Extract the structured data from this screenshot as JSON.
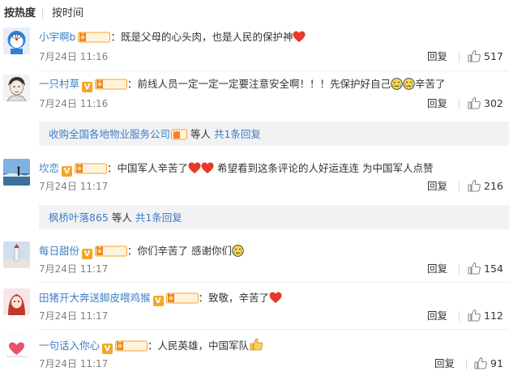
{
  "sort": {
    "hot": "按热度",
    "time": "按时间"
  },
  "labels": {
    "reply": "回复",
    "fan": "铁粉"
  },
  "colors": {
    "link": "#3b7fc4",
    "heart": "#e8382a",
    "badge": "#f5a623"
  },
  "comments": [
    {
      "user": "小宇啊b",
      "text": "：既是父母的心头肉，也是人民的保护神",
      "time": "7月24日 11:16",
      "likes": "517"
    },
    {
      "user": "一只村草",
      "text": "：前线人员一定一定一定要注意安全啊！！！先保护好自己",
      "text2": "辛苦了",
      "time": "7月24日 11:16",
      "likes": "302"
    },
    {
      "user": "坎恋",
      "text": "：中国军人辛苦了",
      "text2": " 希望看到这条评论的人好运连连 为中国军人点赞",
      "time": "7月24日 11:17",
      "likes": "216"
    },
    {
      "user": "每日甜份",
      "text": "：你们辛苦了 感谢你们",
      "time": "7月24日 11:17",
      "likes": "154"
    },
    {
      "user": "田猪开大奔送脚皮喂鸡猴",
      "text": "：致敬，辛苦了",
      "time": "7月24日 11:17",
      "likes": "112"
    },
    {
      "user": "一句话入你心",
      "text": "：人民英雄，中国军队",
      "time": "7月24日 11:17",
      "likes": "91"
    }
  ],
  "subreplies": [
    {
      "user": "收购全国各地物业服务公司",
      "mid": " 等人 ",
      "link": "共1条回复"
    },
    {
      "user": "枫桥叶落865",
      "mid": " 等人 ",
      "link": "共1条回复"
    }
  ]
}
